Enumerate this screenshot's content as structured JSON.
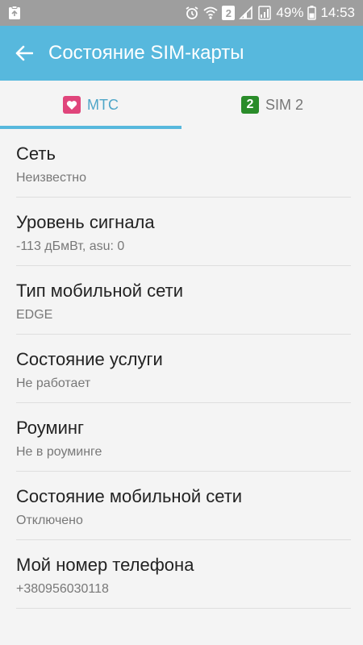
{
  "status_bar": {
    "battery": "49%",
    "time": "14:53",
    "sim_slot": "2",
    "icons": [
      "clipboard-icon",
      "alarm-icon",
      "wifi-icon",
      "signal-icon",
      "battery-icon"
    ]
  },
  "app_bar": {
    "title": "Состояние SIM-карты",
    "back_icon": "arrow-left-icon"
  },
  "tabs": [
    {
      "label": "МТС",
      "badge_icon": "heart-icon",
      "badge_color": "#e0457b",
      "active": true
    },
    {
      "label": "SIM 2",
      "badge_text": "2",
      "badge_color": "#2a8c2a",
      "active": false
    }
  ],
  "items": [
    {
      "label": "Сеть",
      "value": "Неизвестно"
    },
    {
      "label": "Уровень сигнала",
      "value": "-113 дБмВт, asu: 0"
    },
    {
      "label": "Тип мобильной сети",
      "value": "EDGE"
    },
    {
      "label": "Состояние услуги",
      "value": "Не работает"
    },
    {
      "label": "Роуминг",
      "value": "Не в роуминге"
    },
    {
      "label": "Состояние мобильной сети",
      "value": "Отключено"
    },
    {
      "label": "Мой номер телефона",
      "value": "+380956030118"
    }
  ],
  "colors": {
    "accent": "#57b8dd",
    "status_bar": "#9e9e9e",
    "background": "#f4f4f4"
  }
}
